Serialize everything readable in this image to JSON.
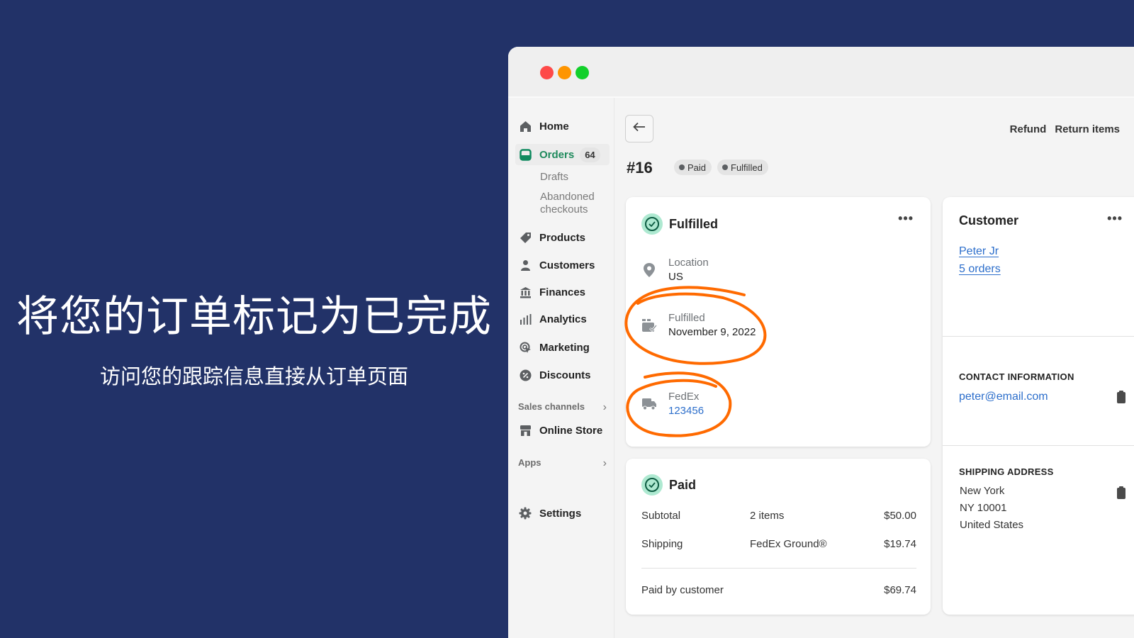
{
  "promo": {
    "headline": "将您的订单标记为已完成",
    "subheadline": "访问您的跟踪信息直接从订单页面"
  },
  "window": {
    "traffic_lights": [
      "close",
      "minimize",
      "maximize"
    ]
  },
  "sidebar": {
    "items": [
      {
        "label": "Home",
        "icon": "home-icon"
      },
      {
        "label": "Orders",
        "icon": "orders-icon",
        "badge": "64",
        "active": true
      },
      {
        "label": "Products",
        "icon": "tag-icon"
      },
      {
        "label": "Customers",
        "icon": "person-icon"
      },
      {
        "label": "Finances",
        "icon": "bank-icon"
      },
      {
        "label": "Analytics",
        "icon": "bar-chart-icon"
      },
      {
        "label": "Marketing",
        "icon": "target-cursor-icon"
      },
      {
        "label": "Discounts",
        "icon": "discount-icon"
      }
    ],
    "orders_subitems": [
      "Drafts",
      "Abandoned checkouts"
    ],
    "sales_channels_label": "Sales channels",
    "online_store_label": "Online Store",
    "apps_label": "Apps",
    "settings_label": "Settings"
  },
  "header": {
    "order_number": "#16",
    "status_pills": [
      "Paid",
      "Fulfilled"
    ],
    "actions": {
      "refund": "Refund",
      "return_items": "Return items"
    }
  },
  "fulfillment_card": {
    "title": "Fulfilled",
    "location_label": "Location",
    "location_value": "US",
    "fulfilled_label": "Fulfilled",
    "fulfilled_date": "November 9, 2022",
    "carrier": "FedEx",
    "tracking_number": "123456"
  },
  "payment_card": {
    "title": "Paid",
    "rows": [
      {
        "label": "Subtotal",
        "detail": "2 items",
        "amount": "$50.00"
      },
      {
        "label": "Shipping",
        "detail": "FedEx Ground®",
        "amount": "$19.74"
      }
    ],
    "total_label": "Paid by customer",
    "total_amount": "$69.74"
  },
  "customer_card": {
    "title": "Customer",
    "name": "Peter Jr",
    "orders": "5 orders",
    "contact_heading": "CONTACT INFORMATION",
    "email": "peter@email.com",
    "shipping_heading": "SHIPPING ADDRESS",
    "address_lines": [
      "New York",
      "NY 10001",
      "United States"
    ]
  },
  "colors": {
    "background": "#223268",
    "accent_green": "#1e8a5c",
    "link_blue": "#2c6ecb",
    "annotation_orange": "#ff6a00"
  }
}
